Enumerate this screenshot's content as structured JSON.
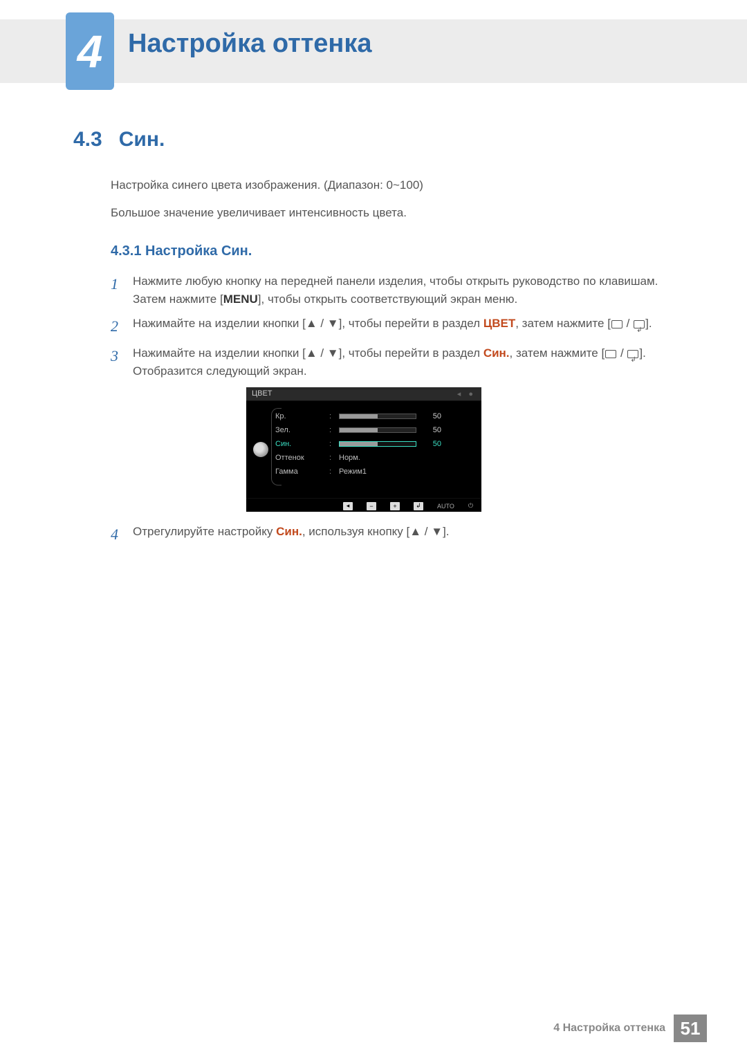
{
  "chapter": {
    "number": "4",
    "title": "Настройка оттенка"
  },
  "section": {
    "number": "4.3",
    "title": "Син."
  },
  "intro": {
    "p1": "Настройка синего цвета изображения. (Диапазон: 0~100)",
    "p2": "Большое значение увеличивает интенсивность цвета."
  },
  "subsection": {
    "label": "4.3.1 Настройка Син."
  },
  "steps": {
    "s1": {
      "num": "1",
      "t1": "Нажмите любую кнопку на передней панели изделия, чтобы открыть руководство по клавишам. Затем нажмите [",
      "menu": "MENU",
      "t2": "], чтобы открыть соответствующий экран меню."
    },
    "s2": {
      "num": "2",
      "t1": "Нажимайте на изделии кнопки [",
      "arrows": "▲ / ▼",
      "t2": "], чтобы перейти в раздел ",
      "kw": "ЦВЕТ",
      "t3": ", затем нажмите [",
      "t4": "]."
    },
    "s3": {
      "num": "3",
      "t1": "Нажимайте на изделии кнопки [",
      "arrows": "▲ / ▼",
      "t2": "], чтобы перейти в раздел ",
      "kw": "Син.",
      "t3": ", затем нажмите [",
      "t4": "]. Отобразится следующий экран."
    },
    "s4": {
      "num": "4",
      "t1": "Отрегулируйте настройку ",
      "kw": "Син.",
      "t2": ", используя кнопку [",
      "arrows": "▲ / ▼",
      "t3": "]."
    }
  },
  "osd": {
    "title": "ЦВЕТ",
    "rows": {
      "r1": {
        "label": "Кр.",
        "value": "50"
      },
      "r2": {
        "label": "Зел.",
        "value": "50"
      },
      "r3": {
        "label": "Син.",
        "value": "50"
      },
      "r4": {
        "label": "Оттенок",
        "text": "Норм."
      },
      "r5": {
        "label": "Гамма",
        "text": "Режим1"
      }
    },
    "footer": {
      "auto": "AUTO"
    }
  },
  "footer": {
    "text": "4 Настройка оттенка",
    "page": "51"
  }
}
